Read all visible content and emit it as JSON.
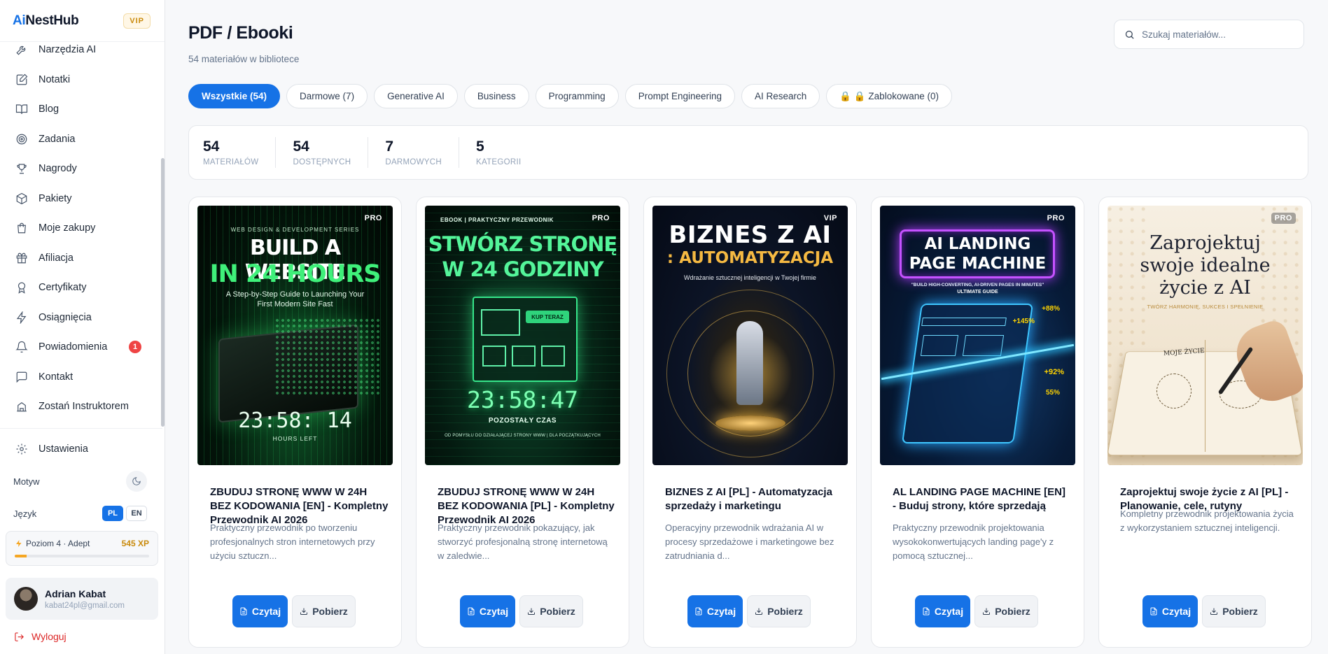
{
  "app": {
    "logo_ai": "Ai",
    "logo_rest": "NestHub",
    "vip": "VIP"
  },
  "sidebar": {
    "items": [
      {
        "label": "Narzędzia AI",
        "icon": "wrench-icon"
      },
      {
        "label": "Notatki",
        "icon": "note-icon"
      },
      {
        "label": "Blog",
        "icon": "book-icon"
      },
      {
        "label": "Zadania",
        "icon": "target-icon"
      },
      {
        "label": "Nagrody",
        "icon": "trophy-icon"
      },
      {
        "label": "Pakiety",
        "icon": "package-icon"
      },
      {
        "label": "Moje zakupy",
        "icon": "shopping-bag-icon"
      },
      {
        "label": "Afiliacja",
        "icon": "gift-icon"
      },
      {
        "label": "Certyfikaty",
        "icon": "award-icon"
      },
      {
        "label": "Osiągnięcia",
        "icon": "lightning-icon"
      },
      {
        "label": "Powiadomienia",
        "icon": "bell-icon",
        "badge": "1"
      },
      {
        "label": "Kontakt",
        "icon": "message-icon"
      },
      {
        "label": "Zostań Instruktorem",
        "icon": "school-icon"
      }
    ],
    "settings_label": "Ustawienia",
    "theme_label": "Motyw",
    "language_label": "Język",
    "lang_pl": "PL",
    "lang_en": "EN",
    "level_label": "Poziom 4 · Adept",
    "level_xp": "545 XP",
    "level_progress": 0.09,
    "user_name": "Adrian Kabat",
    "user_email": "kabat24pl@gmail.com",
    "logout_label": "Wyloguj"
  },
  "main": {
    "title": "PDF / Ebooki",
    "subtitle": "54 materiałów w bibliotece",
    "search_placeholder": "Szukaj materiałów...",
    "tabs": [
      {
        "label": "Wszystkie (54)",
        "active": true
      },
      {
        "label": "Darmowe (7)"
      },
      {
        "label": "Generative AI"
      },
      {
        "label": "Business"
      },
      {
        "label": "Programming"
      },
      {
        "label": "Prompt Engineering"
      },
      {
        "label": "AI Research"
      },
      {
        "label": "🔒 🔒 Zablokowane (0)"
      }
    ],
    "stats": [
      {
        "value": "54",
        "label": "MATERIAŁÓW"
      },
      {
        "value": "54",
        "label": "DOSTĘPNYCH"
      },
      {
        "value": "7",
        "label": "DARMOWYCH"
      },
      {
        "value": "5",
        "label": "KATEGORII"
      }
    ],
    "cards": [
      {
        "badge": "PRO",
        "title": "ZBUDUJ STRONĘ WWW W 24H BEZ KODOWANIA [EN] - Kompletny Przewodnik AI 2026",
        "desc": "Praktyczny przewodnik po tworzeniu profesjonalnych stron internetowych przy użyciu sztuczn...",
        "cover": {
          "top": "WEB DESIGN & DEVELOPMENT SERIES",
          "line1": "BUILD A WEBSITE",
          "line2": "IN 24 HOURS",
          "sub": "A Step-by-Step Guide to Launching Your First Modern Site Fast",
          "clock": "23:58: 14",
          "foot": "HOURS LEFT"
        }
      },
      {
        "badge": "PRO",
        "title": "ZBUDUJ STRONĘ WWW W 24H BEZ KODOWANIA [PL] - Kompletny Przewodnik AI 2026",
        "desc": "Praktyczny przewodnik pokazujący, jak stworzyć profesjonalną stronę internetową w zaledwie...",
        "cover": {
          "top": "EBOOK | PRAKTYCZNY PRZEWODNIK",
          "line1": "STWÓRZ STRONĘ",
          "line2": "W 24 GODZINY",
          "sub": "KUP TERAZ",
          "clock": "23:58:47",
          "foot": "POZOSTAŁY CZAS",
          "foot2": "OD POMYSŁU DO DZIAŁAJĄCEJ STRONY WWW | DLA POCZĄTKUJĄCYCH"
        }
      },
      {
        "badge": "VIP",
        "title": "BIZNES Z AI [PL] - Automatyzacja sprzedaży i marketingu",
        "desc": "Operacyjny przewodnik wdrażania AI w procesy sprzedażowe i marketingowe bez zatrudniania d...",
        "cover": {
          "line1": "BIZNES Z AI",
          "line2": ": AUTOMATYZACJA",
          "sub": "Wdrażanie sztucznej inteligencji w Twojej firmie"
        }
      },
      {
        "badge": "PRO",
        "title": "AL LANDING PAGE MACHINE [EN] - Buduj strony, które sprzedają",
        "desc": "Praktyczny przewodnik projektowania wysokokonwertujących landing page'y z pomocą sztucznej...",
        "cover": {
          "line1": "AI LANDING",
          "line2": "PAGE MACHINE",
          "sub": "\"BUILD HIGH-CONVERTING, AI-DRIVEN PAGES IN MINUTES\"",
          "sub2": "ULTIMATE GUIDE",
          "stat1": "+88%",
          "stat2": "+145%",
          "stat3": "+92%",
          "stat4": "55%"
        }
      },
      {
        "badge": "PRO",
        "title": "Zaprojektuj swoje życie z AI [PL] - Planowanie, cele, rutyny",
        "desc": "Kompletny przewodnik projektowania życia z wykorzystaniem sztucznej inteligencji.",
        "cover": {
          "line1": "Zaprojektuj",
          "line2": "swoje idealne",
          "line3": "życie z AI",
          "sub": "TWÓRZ HARMONIĘ, SUKCES I SPEŁNIENIE",
          "note": "MOJE ŻYCIE"
        }
      }
    ],
    "read_label": "Czytaj",
    "download_label": "Pobierz"
  }
}
